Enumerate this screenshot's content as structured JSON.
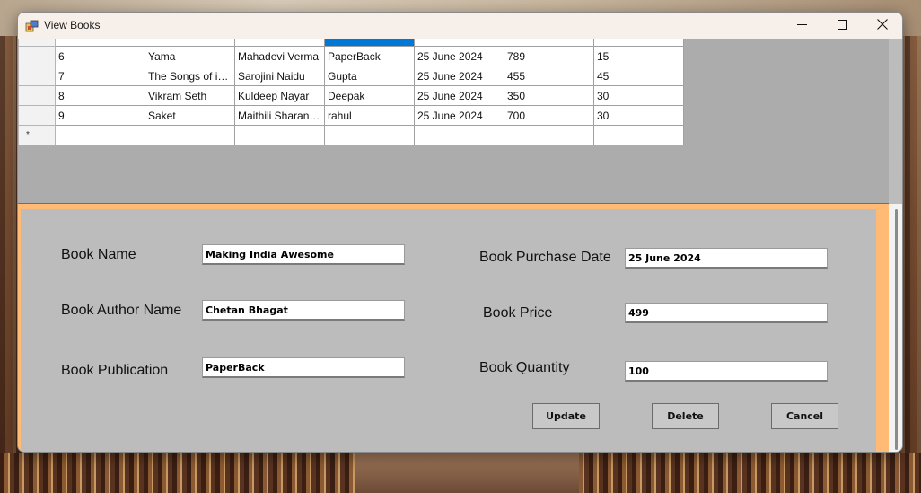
{
  "window": {
    "title": "View Books",
    "controls": {
      "minimize_icon": "minimize-icon",
      "maximize_icon": "maximize-icon",
      "close_icon": "close-icon"
    }
  },
  "grid": {
    "partial_row": [
      "",
      "",
      "",
      "",
      "",
      "",
      ""
    ],
    "rows": [
      [
        "6",
        "Yama",
        "Mahadevi Verma",
        "PaperBack",
        "25 June 2024",
        "789",
        "15"
      ],
      [
        "7",
        "The Songs of india",
        "Sarojini Naidu",
        "Gupta",
        "25 June 2024",
        "455",
        "45"
      ],
      [
        "8",
        "Vikram Seth",
        "Kuldeep Nayar",
        "Deepak",
        "25 June 2024",
        "350",
        "30"
      ],
      [
        "9",
        "Saket",
        "Maithili Sharan G...",
        "rahul",
        "25 June 2024",
        "700",
        "30"
      ]
    ],
    "new_row_marker": "*"
  },
  "form": {
    "book_name_label": "Book Name",
    "book_name_value": "Making India Awesome",
    "author_label": "Book Author Name",
    "author_value": "Chetan Bhagat",
    "publication_label": "Book Publication",
    "publication_value": "PaperBack",
    "purchase_date_label": "Book Purchase Date",
    "purchase_date_value": "25 June 2024",
    "price_label": "Book Price",
    "price_value": "499",
    "quantity_label": "Book Quantity",
    "quantity_value": "100"
  },
  "buttons": {
    "update": "Update",
    "delete": "Delete",
    "cancel": "Cancel"
  },
  "colors": {
    "panel_accent": "#ffba75",
    "selection": "#0078d7",
    "form_background": "#bcbcbc"
  }
}
